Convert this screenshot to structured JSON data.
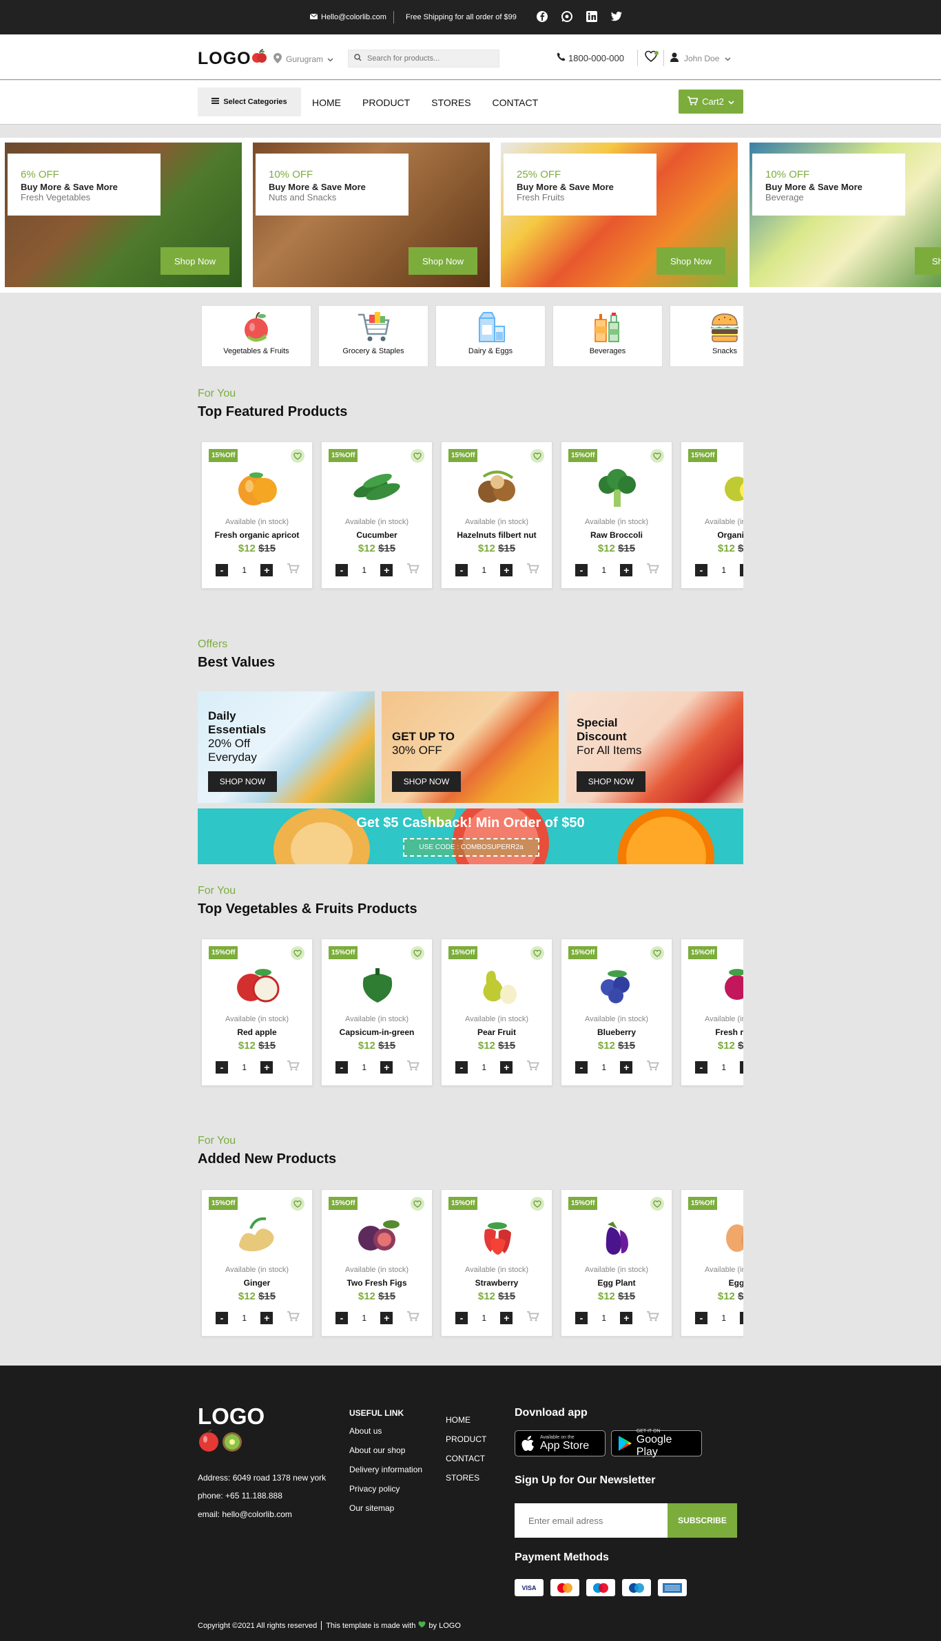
{
  "topbar": {
    "email": "Hello@colorlib.com",
    "shipping": "Free Shipping for all order of $99",
    "social": [
      "facebook-icon",
      "whatsapp-icon",
      "linkedin-icon",
      "twitter-icon"
    ]
  },
  "header": {
    "logo": "LOGO",
    "location": "Gurugram",
    "search_placeholder": "Search for products...",
    "phone": "1800-000-000",
    "user": "John Doe",
    "wishlist_count": ""
  },
  "nav": {
    "select_categories": "Select Categories",
    "items": [
      "HOME",
      "PRODUCT",
      "STORES",
      "CONTACT"
    ],
    "cart": "Cart2"
  },
  "banners": [
    {
      "pct": "6% OFF",
      "line1": "Buy More & Save More",
      "line2": "Fresh Vegetables",
      "button": "Shop Now"
    },
    {
      "pct": "10% OFF",
      "line1": "Buy More & Save More",
      "line2": "Nuts and Snacks",
      "button": "Shop Now"
    },
    {
      "pct": "25% OFF",
      "line1": "Buy More & Save More",
      "line2": "Fresh Fruits",
      "button": "Shop Now"
    },
    {
      "pct": "10% OFF",
      "line1": "Buy More & Save More",
      "line2": "Beverage",
      "button": "Shop"
    }
  ],
  "categories": [
    "Vegetables & Fruits",
    "Grocery & Staples",
    "Dairy & Eggs",
    "Beverages",
    "Snacks"
  ],
  "sections": {
    "featured": {
      "sub": "For You",
      "title": "Top Featured Products"
    },
    "offers": {
      "sub": "Offers",
      "title": "Best Values"
    },
    "vegfruits": {
      "sub": "For You",
      "title": "Top Vegetables & Fruits Products"
    },
    "newprod": {
      "sub": "For You",
      "title": "Added New Products"
    }
  },
  "product_common": {
    "badge": "15%Off",
    "avail": "Available (in stock)",
    "price": "$12",
    "old_price": "$15",
    "qty": "1",
    "minus": "-",
    "plus": "+"
  },
  "featured_products": [
    "Fresh organic apricot",
    "Cucumber",
    "Hazelnuts filbert nut",
    "Raw Broccoli",
    "Organic c"
  ],
  "vegfruit_products": [
    "Red apple",
    "Capsicum-in-green",
    "Pear Fruit",
    "Blueberry",
    "Fresh rasp"
  ],
  "new_products": [
    "Ginger",
    "Two Fresh Figs",
    "Strawberry",
    "Egg Plant",
    "Egg"
  ],
  "offers": [
    {
      "l1": "Daily",
      "l2": "Essentials",
      "l3": "20% Off",
      "l4": "Everyday",
      "button": "SHOP NOW"
    },
    {
      "l1": "GET UP TO",
      "l2": "30% OFF",
      "button": "SHOP NOW"
    },
    {
      "l1": "Special",
      "l2": "Discount",
      "l3": "For All Items",
      "button": "SHOP NOW"
    }
  ],
  "cashback": {
    "text": "Get $5 Cashback! Min Order of $50",
    "code": "USE CODE : COMBOSUPERR2a"
  },
  "footer": {
    "logo": "LOGO",
    "address": "Address: 6049 road 1378 new york",
    "phone": "phone: +65 11.188.888",
    "email": "email: hello@colorlib.com",
    "useful_title": "USEFUL LINK",
    "useful": [
      "About us",
      "About our shop",
      "Delivery information",
      "Privacy policy",
      "Our sitemap"
    ],
    "menu": [
      "HOME",
      "PRODUCT",
      "CONTACT",
      "STORES"
    ],
    "app_title": "Dovnload app",
    "appstore_small": "Available on the",
    "appstore": "App Store",
    "gplay_small": "GET IT ON",
    "gplay": "Google Play",
    "news_title": "Sign Up for Our Newsletter",
    "news_placeholder": "Enter email adress",
    "subscribe": "SUBSCRIBE",
    "pay_title": "Payment Methods",
    "payments": [
      "VISA",
      "mastercard",
      "Maestro",
      "Cirrus",
      "AMEX"
    ],
    "copyright": "Copyright ©2021 All rights reserved",
    "made": "This template is made with",
    "by": "by LOGO"
  },
  "colors": {
    "accent": "#7cad3c",
    "dark": "#222222"
  }
}
